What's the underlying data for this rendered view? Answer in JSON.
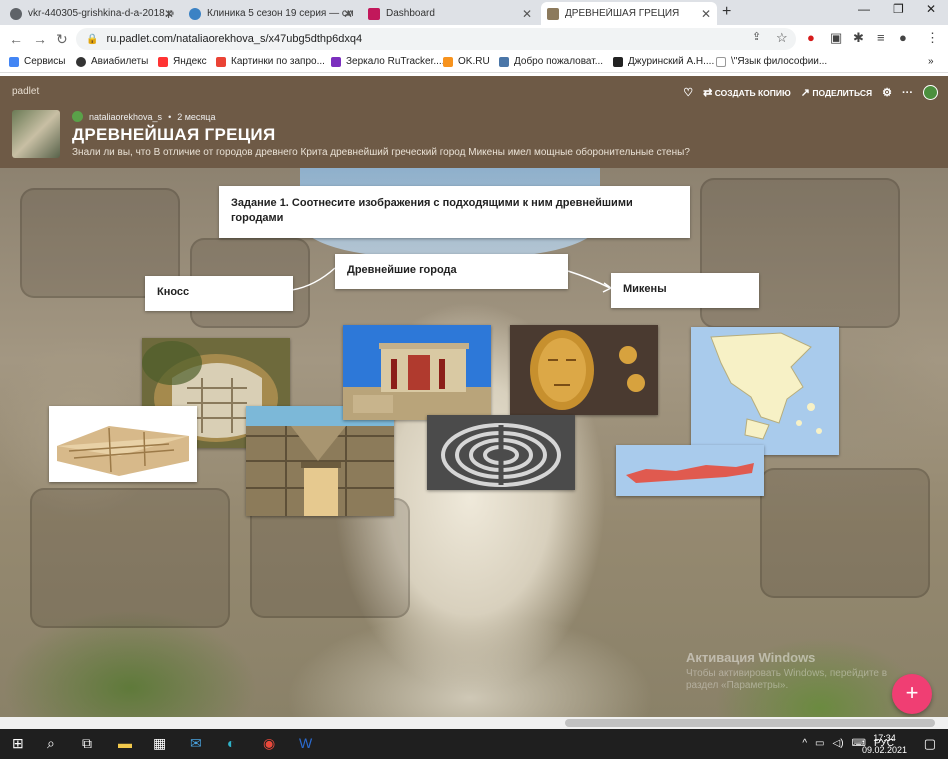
{
  "browser": {
    "tabs": [
      {
        "title": "vkr-440305-grishkina-d-a-2018.pdf",
        "active": false
      },
      {
        "title": "Клиника 5 сезон 19 серия — смо",
        "active": false
      },
      {
        "title": "Dashboard",
        "active": false
      },
      {
        "title": "ДРЕВНЕЙШАЯ ГРЕЦИЯ",
        "active": true
      }
    ],
    "url": "ru.padlet.com/nataliaorekhova_s/x47ubg5dthp6dxq4",
    "bookmarks": [
      "Сервисы",
      "Авиабилеты",
      "Яндекс",
      "Картинки по запро...",
      "Зеркало RuTracker....",
      "OK.RU",
      "Добро пожаловат...",
      "Джуринский А.Н....",
      "\\\"Язык философии..."
    ]
  },
  "padlet": {
    "brand": "padlet",
    "actions": {
      "remake": "СОЗДАТЬ КОПИЮ",
      "share": "ПОДЕЛИТЬСЯ"
    },
    "author": "nataliaorekhova_s",
    "age": "2 месяца",
    "title": "ДРЕВНЕЙШАЯ ГРЕЦИЯ",
    "description": "Знали ли вы, что В отличие от городов древнего Крита древнейший греческий город Микены имел мощные оборонительные стены?"
  },
  "cards": {
    "task": "Задание 1. Соотнесите изображения с подходящими к ним древнейшими городами",
    "cities": "Древнейшие  города",
    "knossos": "Кносс",
    "mycenae": "Микены"
  },
  "photos": [
    "knossos-aerial-photo",
    "palace-reconstruction-photo",
    "lion-gate-photo",
    "knossos-palace-photo",
    "labyrinth-photo",
    "agamemnon-mask-photo",
    "greece-map",
    "crete-map"
  ],
  "watermark": {
    "title": "Активация Windows",
    "text": "Чтобы активировать Windows, перейдите в раздел «Параметры»."
  },
  "fab_label": "+",
  "taskbar": {
    "time": "17:34",
    "date": "09.02.2021",
    "lang": "РУС"
  },
  "colors": {
    "header": "#6e5a46",
    "fab": "#f03e73",
    "map_sea": "#a9cbec",
    "map_land": "#f7f1c6",
    "crete": "#e05a4f"
  }
}
